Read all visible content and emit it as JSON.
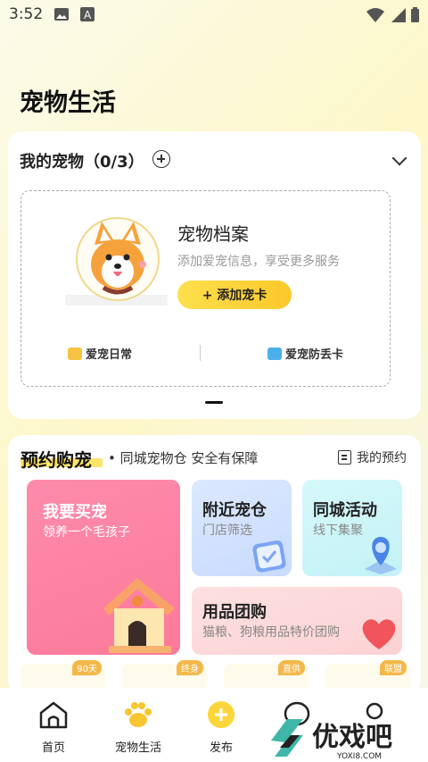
{
  "status": {
    "time": "3:52"
  },
  "page_title": "宠物生活",
  "pets": {
    "header": "我的宠物（0/3）",
    "archive_title": "宠物档案",
    "archive_desc": "添加爱宠信息，享受更多服务",
    "add_card_label": "+ 添加宠卡",
    "daily_label": "爱宠日常",
    "lost_card_label": "爱宠防丢卡"
  },
  "shop": {
    "title": "预约购宠",
    "subtitle": "• 同城宠物仓 安全有保障",
    "my_booking": "我的预约",
    "tiles": {
      "buy": {
        "title": "我要买宠",
        "sub": "领养一个毛孩子"
      },
      "near": {
        "title": "附近宠仓",
        "sub": "门店筛选"
      },
      "event": {
        "title": "同城活动",
        "sub": "线下集聚"
      },
      "group": {
        "title": "用品团购",
        "sub": "猫粮、狗粮用品特价团购"
      }
    },
    "strip_badges": [
      "90天",
      "终身",
      "直供",
      "联盟"
    ]
  },
  "tabbar": {
    "home": "首页",
    "pet_life": "宠物生活",
    "publish": "发布"
  },
  "watermark": {
    "brand": "优戏吧",
    "url": "YOXI8.COM"
  },
  "colors": {
    "accent_yellow": "#fcd53a",
    "pink_tile": "#fc7a9a",
    "blue_tile": "#c9dbfd",
    "cyan_tile": "#c3f2f6"
  }
}
